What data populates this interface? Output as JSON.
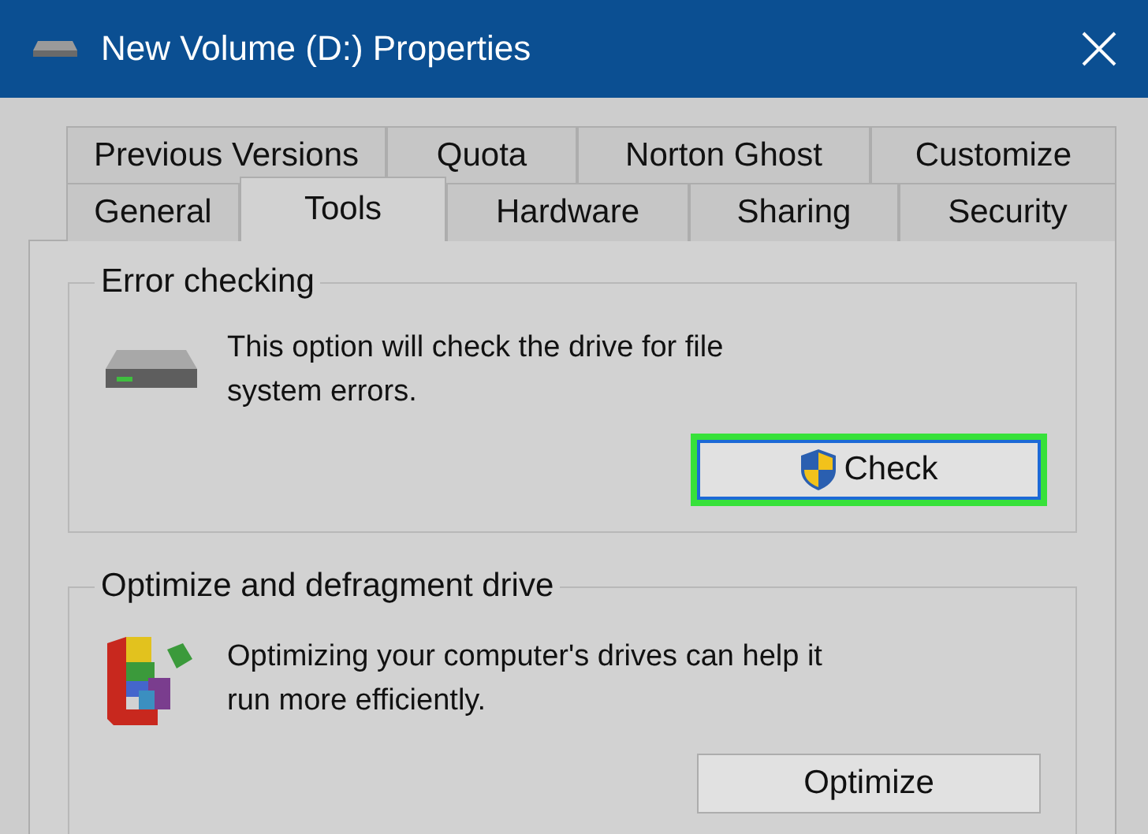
{
  "window": {
    "title": "New Volume (D:) Properties"
  },
  "tab_rows": [
    {
      "tabs": [
        {
          "label": "Previous Versions",
          "selected": false
        },
        {
          "label": "Quota",
          "selected": false
        },
        {
          "label": "Norton Ghost",
          "selected": false
        },
        {
          "label": "Customize",
          "selected": false
        }
      ]
    },
    {
      "tabs": [
        {
          "label": "General",
          "selected": false
        },
        {
          "label": "Tools",
          "selected": true
        },
        {
          "label": "Hardware",
          "selected": false
        },
        {
          "label": "Sharing",
          "selected": false
        },
        {
          "label": "Security",
          "selected": false
        }
      ]
    }
  ],
  "groups": [
    {
      "kind": "error-checking",
      "title": "Error checking",
      "text": "This option will check the drive for file system errors.",
      "button": {
        "label": "Check",
        "shield": true,
        "highlighted": true
      }
    },
    {
      "kind": "optimize",
      "title": "Optimize and defragment drive",
      "text": "Optimizing your computer's drives can help it run more efficiently.",
      "button": {
        "label": "Optimize",
        "shield": false,
        "highlighted": false
      }
    }
  ]
}
